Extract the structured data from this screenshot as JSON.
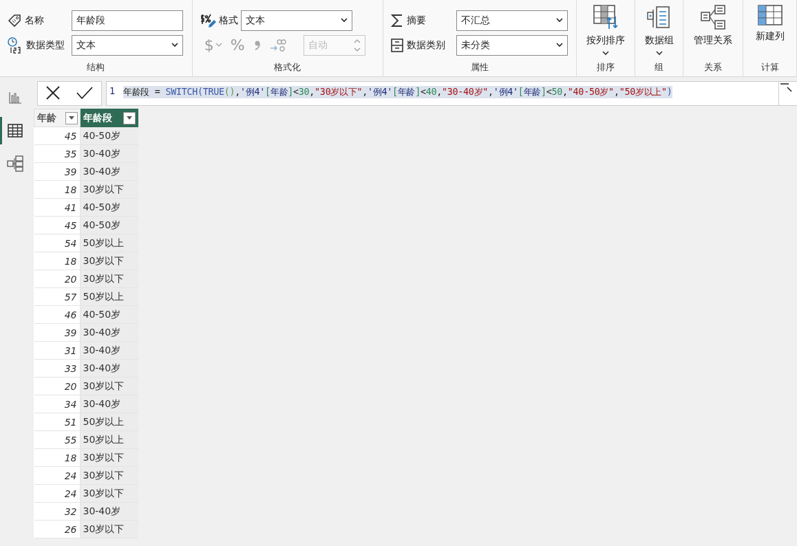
{
  "ribbon": {
    "groups": [
      {
        "kind": "structure",
        "label": "结构",
        "fields": [
          {
            "kind": "input",
            "label": "名称",
            "value": "年龄段"
          },
          {
            "kind": "select",
            "label": "数据类型",
            "value": "文本"
          }
        ]
      },
      {
        "kind": "format",
        "label": "格式化",
        "format_field": {
          "label": "格式",
          "value": "文本"
        },
        "format_buttons": [
          {
            "kind": "currency",
            "disabled": true,
            "text": "$"
          },
          {
            "kind": "percent",
            "disabled": true,
            "text": "%"
          },
          {
            "kind": "comma",
            "disabled": true
          },
          {
            "kind": "decimals",
            "disabled": true
          }
        ],
        "decimal_field": {
          "value": "自动",
          "disabled": true
        }
      },
      {
        "kind": "properties",
        "label": "属性",
        "fields": [
          {
            "kind": "select",
            "label": "摘要",
            "value": "不汇总"
          },
          {
            "kind": "select",
            "label": "数据类别",
            "value": "未分类"
          }
        ]
      },
      {
        "kind": "big",
        "label": "排序",
        "button": {
          "kind": "sort",
          "text": "按列排序",
          "has_menu": true
        }
      },
      {
        "kind": "big",
        "label": "组",
        "button": {
          "kind": "groups",
          "text": "数据组",
          "has_menu": true
        }
      },
      {
        "kind": "big",
        "label": "关系",
        "button": {
          "kind": "relations",
          "text": "管理关系",
          "has_menu": false
        }
      },
      {
        "kind": "big",
        "label": "计算",
        "button": {
          "kind": "newcol",
          "text": "新建列",
          "has_menu": false
        }
      }
    ]
  },
  "views": [
    {
      "kind": "report",
      "selected": false
    },
    {
      "kind": "table",
      "selected": true
    },
    {
      "kind": "model",
      "selected": false
    }
  ],
  "formula": {
    "line_number": "1",
    "tokens": [
      {
        "kind": "plain",
        "text": "年龄段"
      },
      {
        "kind": "plain",
        "text": " = "
      },
      {
        "kind": "func",
        "text": "SWITCH"
      },
      {
        "kind": "paren1",
        "text": "("
      },
      {
        "kind": "func",
        "text": "TRUE"
      },
      {
        "kind": "paren2",
        "text": "()"
      },
      {
        "kind": "plain",
        "text": ","
      },
      {
        "kind": "table",
        "text": "'例4'"
      },
      {
        "kind": "bracket",
        "text": "["
      },
      {
        "kind": "table",
        "text": "年龄"
      },
      {
        "kind": "bracket",
        "text": "]"
      },
      {
        "kind": "plain",
        "text": "<"
      },
      {
        "kind": "number",
        "text": "30"
      },
      {
        "kind": "plain",
        "text": ","
      },
      {
        "kind": "string",
        "text": "\"30岁以下\""
      },
      {
        "kind": "plain",
        "text": ","
      },
      {
        "kind": "table",
        "text": "'例4'"
      },
      {
        "kind": "bracket",
        "text": "["
      },
      {
        "kind": "table",
        "text": "年龄"
      },
      {
        "kind": "bracket",
        "text": "]"
      },
      {
        "kind": "plain",
        "text": "<"
      },
      {
        "kind": "number",
        "text": "40"
      },
      {
        "kind": "plain",
        "text": ","
      },
      {
        "kind": "string",
        "text": "\"30-40岁\""
      },
      {
        "kind": "plain",
        "text": ","
      },
      {
        "kind": "table",
        "text": "'例4'"
      },
      {
        "kind": "bracket",
        "text": "["
      },
      {
        "kind": "table",
        "text": "年龄"
      },
      {
        "kind": "bracket",
        "text": "]"
      },
      {
        "kind": "plain",
        "text": "<"
      },
      {
        "kind": "number",
        "text": "50"
      },
      {
        "kind": "plain",
        "text": ","
      },
      {
        "kind": "string",
        "text": "\"40-50岁\""
      },
      {
        "kind": "plain",
        "text": ","
      },
      {
        "kind": "string",
        "text": "\"50岁以上\""
      },
      {
        "kind": "paren1",
        "text": ")"
      }
    ]
  },
  "table": {
    "columns": [
      {
        "label": "年龄",
        "selected": false
      },
      {
        "label": "年龄段",
        "selected": true
      }
    ],
    "rows": [
      [
        "45",
        "40-50岁"
      ],
      [
        "35",
        "30-40岁"
      ],
      [
        "39",
        "30-40岁"
      ],
      [
        "18",
        "30岁以下"
      ],
      [
        "41",
        "40-50岁"
      ],
      [
        "45",
        "40-50岁"
      ],
      [
        "54",
        "50岁以上"
      ],
      [
        "18",
        "30岁以下"
      ],
      [
        "20",
        "30岁以下"
      ],
      [
        "57",
        "50岁以上"
      ],
      [
        "46",
        "40-50岁"
      ],
      [
        "39",
        "30-40岁"
      ],
      [
        "31",
        "30-40岁"
      ],
      [
        "33",
        "30-40岁"
      ],
      [
        "20",
        "30岁以下"
      ],
      [
        "34",
        "30-40岁"
      ],
      [
        "51",
        "50岁以上"
      ],
      [
        "55",
        "50岁以上"
      ],
      [
        "18",
        "30岁以下"
      ],
      [
        "24",
        "30岁以下"
      ],
      [
        "24",
        "30岁以下"
      ],
      [
        "32",
        "30-40岁"
      ],
      [
        "26",
        "30岁以下"
      ]
    ]
  }
}
